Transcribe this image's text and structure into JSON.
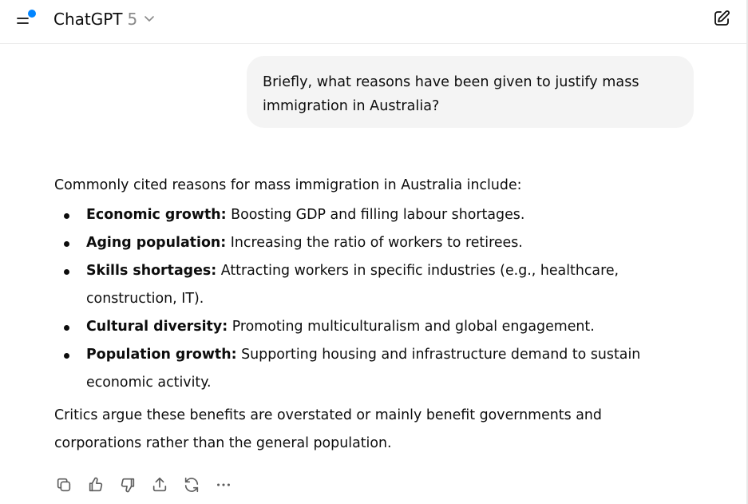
{
  "header": {
    "model_name": "ChatGPT",
    "model_version": "5",
    "accent_dot_color": "#0285ff"
  },
  "conversation": {
    "user_message": "Briefly, what reasons have been given to justify mass immigration in Australia?",
    "assistant": {
      "intro": "Commonly cited reasons for mass immigration in Australia include:",
      "items": [
        {
          "title": "Economic growth:",
          "text": " Boosting GDP and filling labour shortages."
        },
        {
          "title": "Aging population:",
          "text": " Increasing the ratio of workers to retirees."
        },
        {
          "title": "Skills shortages:",
          "text": " Attracting workers in specific industries (e.g., healthcare, construction, IT)."
        },
        {
          "title": "Cultural diversity:",
          "text": " Promoting multiculturalism and global engagement."
        },
        {
          "title": "Population growth:",
          "text": " Supporting housing and infrastructure demand to sustain economic activity."
        }
      ],
      "closing": "Critics argue these benefits are overstated or mainly benefit governments and corporations rather than the general population."
    }
  },
  "icons": {
    "menu": "sidebar-menu-icon",
    "chevron": "chevron-down-icon",
    "new_chat": "new-chat-icon",
    "actions": [
      "copy-icon",
      "thumbs-up-icon",
      "thumbs-down-icon",
      "share-icon",
      "regenerate-icon",
      "more-icon"
    ]
  }
}
